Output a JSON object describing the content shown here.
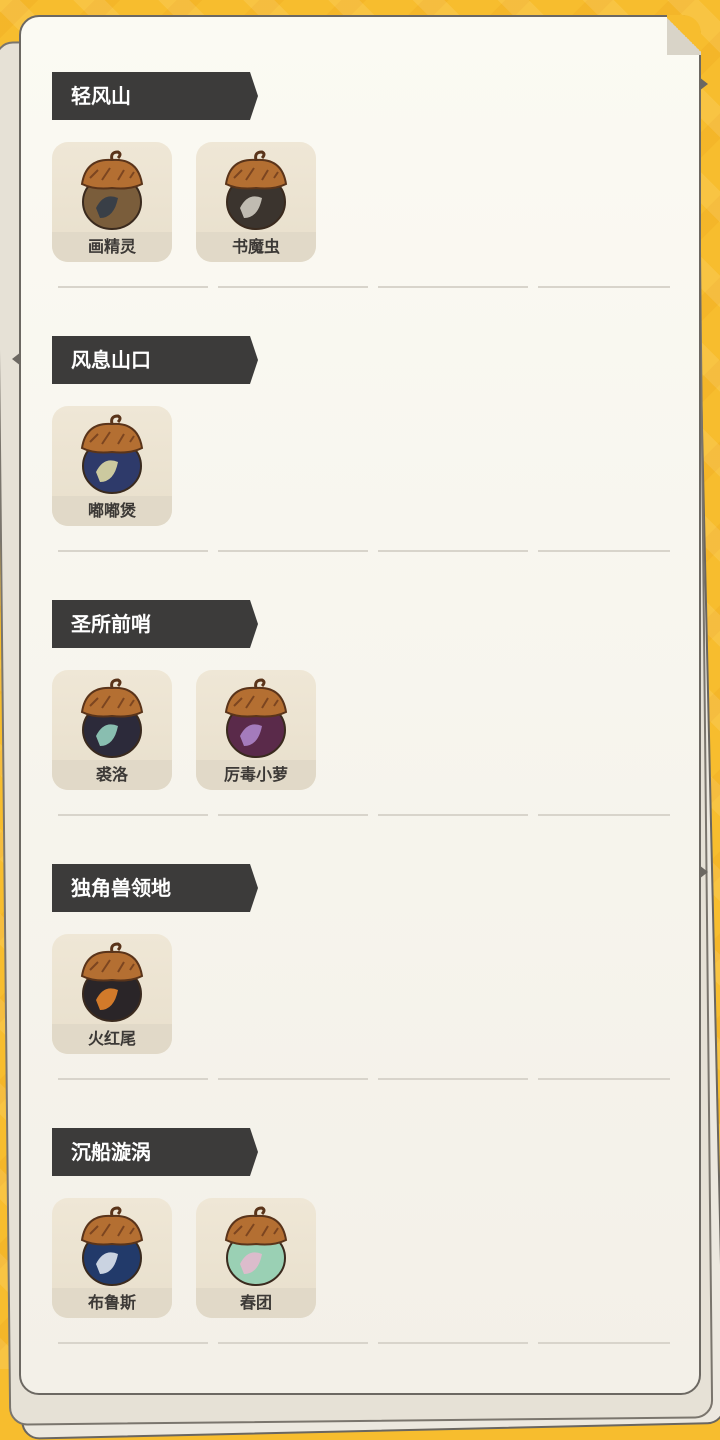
{
  "sections": [
    {
      "title": "轻风山",
      "creatures": [
        {
          "name": "画精灵",
          "icon": "painting-sprite-acorn-icon",
          "body_color": "#7a5d3b",
          "accent_color": "#2e3a4a"
        },
        {
          "name": "书魔虫",
          "icon": "book-bug-acorn-icon",
          "body_color": "#3b342e",
          "accent_color": "#d8d3c8"
        }
      ]
    },
    {
      "title": "风息山口",
      "creatures": [
        {
          "name": "嘟嘟煲",
          "icon": "pot-acorn-icon",
          "body_color": "#2e3a6a",
          "accent_color": "#e8e3a8"
        }
      ]
    },
    {
      "title": "圣所前哨",
      "creatures": [
        {
          "name": "裘洛",
          "icon": "julo-acorn-icon",
          "body_color": "#2c2a3a",
          "accent_color": "#9ad8c6"
        },
        {
          "name": "厉毒小萝",
          "icon": "venom-radish-acorn-icon",
          "body_color": "#5a2a4a",
          "accent_color": "#b28ad0"
        }
      ]
    },
    {
      "title": "独角兽领地",
      "creatures": [
        {
          "name": "火红尾",
          "icon": "fire-tail-acorn-icon",
          "body_color": "#2a2528",
          "accent_color": "#f08a2a"
        }
      ]
    },
    {
      "title": "沉船漩涡",
      "creatures": [
        {
          "name": "布鲁斯",
          "icon": "blues-acorn-icon",
          "body_color": "#223a6a",
          "accent_color": "#e8eef6"
        },
        {
          "name": "春团",
          "icon": "spring-ball-acorn-icon",
          "body_color": "#9ad0b4",
          "accent_color": "#e8b8d0"
        }
      ]
    }
  ]
}
